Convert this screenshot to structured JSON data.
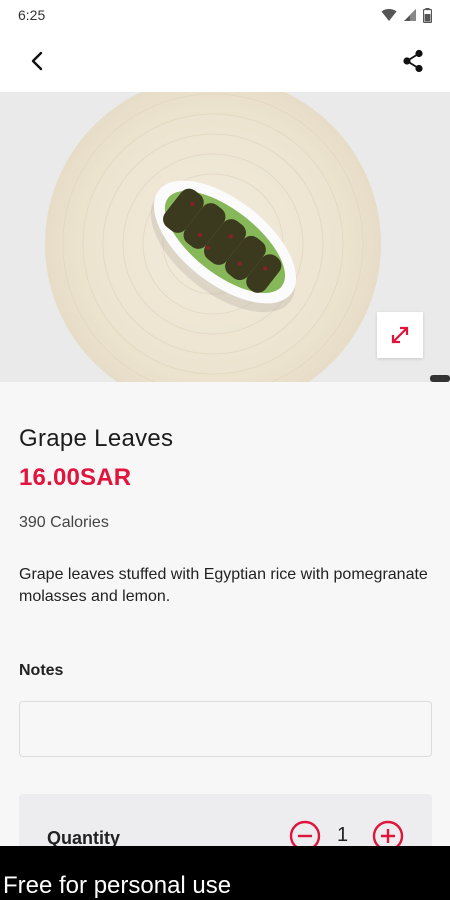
{
  "status_bar": {
    "time": "6:25"
  },
  "nav": {
    "back_icon": "chevron-left-icon",
    "share_icon": "share-icon"
  },
  "product": {
    "name": "Grape Leaves",
    "price": "16.00SAR",
    "calories": "390 Calories",
    "description": "Grape leaves stuffed with Egyptian rice with pomegranate molasses and lemon."
  },
  "notes": {
    "label": "Notes",
    "value": "",
    "placeholder": ""
  },
  "quantity": {
    "label": "Quantity",
    "value": "1"
  },
  "watermark": {
    "text": "Free for personal use"
  },
  "colors": {
    "accent": "#e0143c",
    "background": "#f7f7f7",
    "card": "#ededef"
  }
}
